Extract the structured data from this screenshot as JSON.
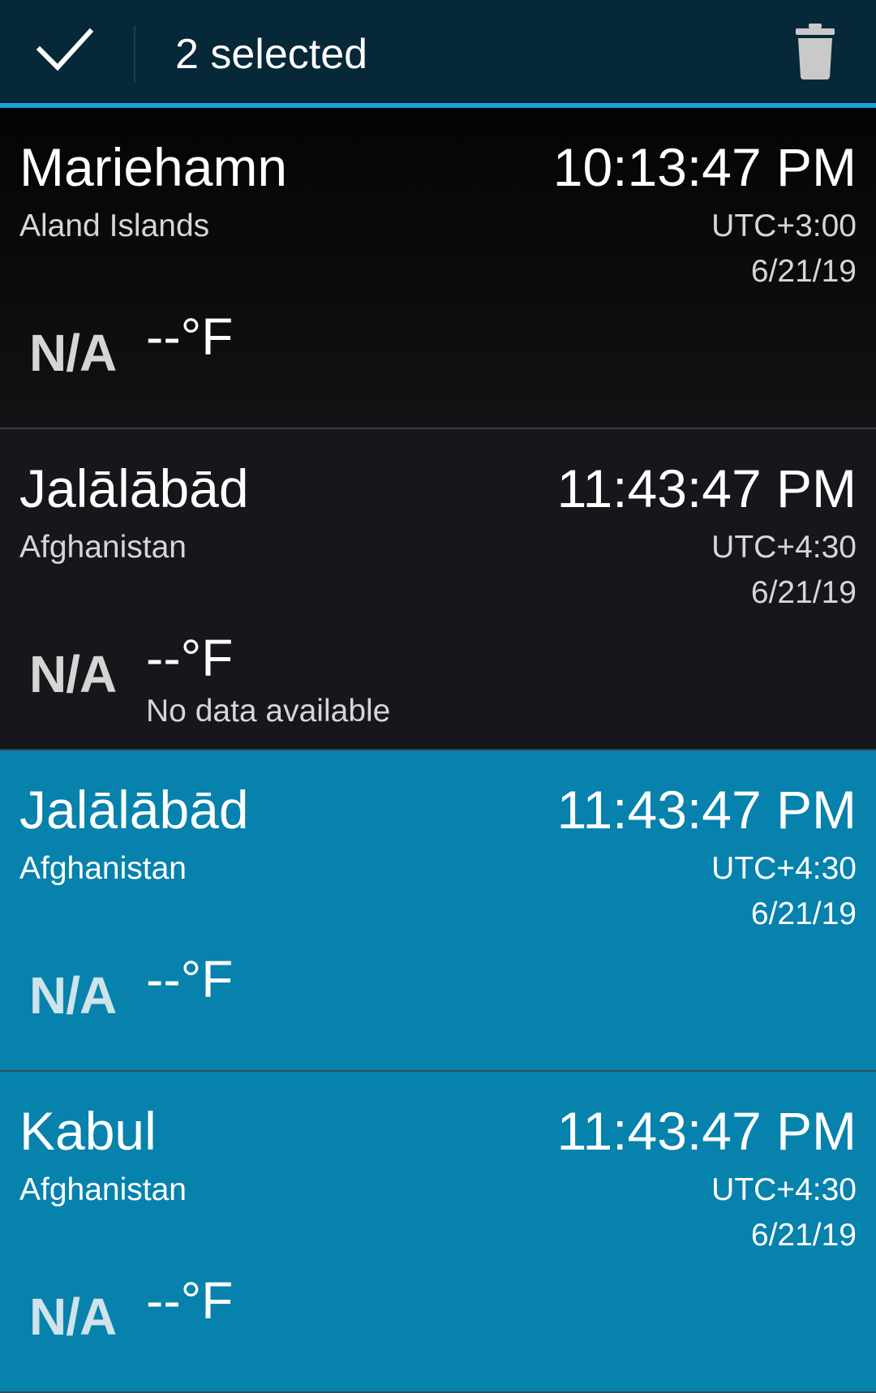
{
  "action_bar": {
    "done_icon": "check-icon",
    "selected_count": "2 selected",
    "delete_icon": "trash-icon"
  },
  "colors": {
    "action_bar_bg": "#062838",
    "accent": "#1aa5d3",
    "selected_row_bg": "#0782ad",
    "row_bg": "#111214"
  },
  "rows": [
    {
      "city": "Mariehamn",
      "country": "Aland Islands",
      "time": "10:13:47 PM",
      "utc_offset": "UTC+3:00",
      "date": "6/21/19",
      "weather_icon": "N/A",
      "temperature": "--°F",
      "condition": "",
      "selected": false
    },
    {
      "city": "Jalālābād",
      "country": "Afghanistan",
      "time": "11:43:47 PM",
      "utc_offset": "UTC+4:30",
      "date": "6/21/19",
      "weather_icon": "N/A",
      "temperature": "--°F",
      "condition": "No data available",
      "selected": false
    },
    {
      "city": "Jalālābād",
      "country": "Afghanistan",
      "time": "11:43:47 PM",
      "utc_offset": "UTC+4:30",
      "date": "6/21/19",
      "weather_icon": "N/A",
      "temperature": "--°F",
      "condition": "",
      "selected": true
    },
    {
      "city": "Kabul",
      "country": "Afghanistan",
      "time": "11:43:47 PM",
      "utc_offset": "UTC+4:30",
      "date": "6/21/19",
      "weather_icon": "N/A",
      "temperature": "--°F",
      "condition": "",
      "selected": true
    }
  ]
}
